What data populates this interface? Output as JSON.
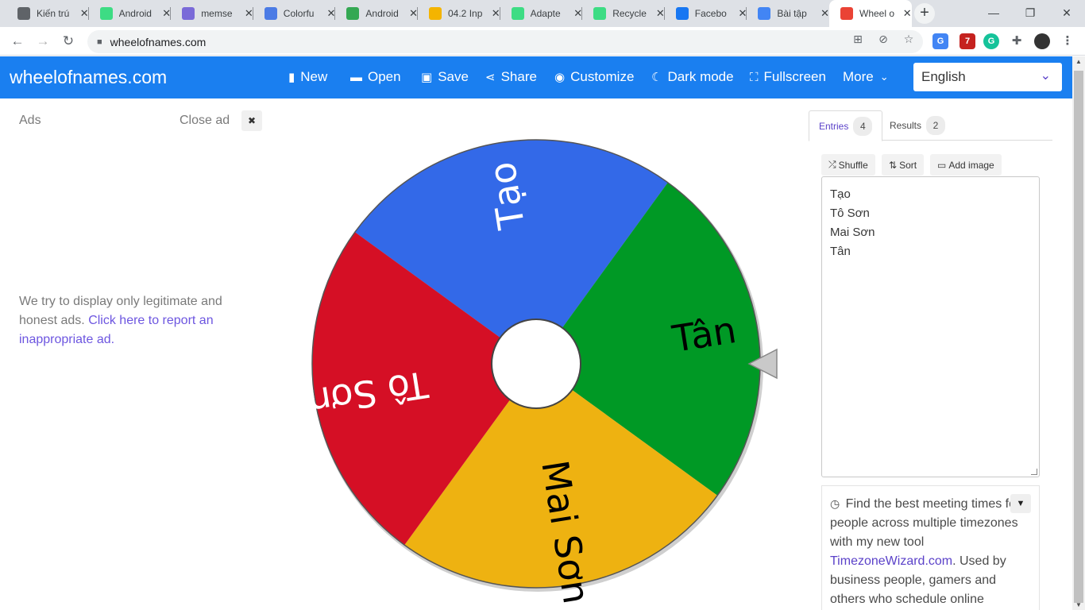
{
  "browser": {
    "tabs": [
      {
        "label": "Kiến trú",
        "fav_color": "#5f6368"
      },
      {
        "label": "Android",
        "fav_color": "#3ddc84"
      },
      {
        "label": "memse",
        "fav_color": "#7a6ad8"
      },
      {
        "label": "Colorfu",
        "fav_color": "#4b7be5"
      },
      {
        "label": "Android",
        "fav_color": "#34a853"
      },
      {
        "label": "04.2 Inp",
        "fav_color": "#f4b400"
      },
      {
        "label": "Adapte",
        "fav_color": "#3ddc84"
      },
      {
        "label": "Recycle",
        "fav_color": "#3ddc84"
      },
      {
        "label": "Facebo",
        "fav_color": "#1877f2"
      },
      {
        "label": "Bài tập",
        "fav_color": "#4285f4"
      },
      {
        "label": "Wheel o",
        "fav_color": "#ea4335"
      }
    ],
    "close_glyph": "✕",
    "new_tab_glyph": "+",
    "window_controls": [
      "—",
      "❐",
      "✕"
    ],
    "url": "wheelofnames.com",
    "ext_badge": "7"
  },
  "app": {
    "brand": "wheelofnames.com",
    "menu": [
      {
        "icon": "file-icon",
        "glyph": "▮",
        "label": "New"
      },
      {
        "icon": "folder-open-icon",
        "glyph": "▬",
        "label": "Open"
      },
      {
        "icon": "save-icon",
        "glyph": "▣",
        "label": "Save"
      },
      {
        "icon": "share-icon",
        "glyph": "⋖",
        "label": "Share"
      },
      {
        "icon": "palette-icon",
        "glyph": "◉",
        "label": "Customize"
      },
      {
        "icon": "moon-icon",
        "glyph": "☾",
        "label": "Dark mode"
      },
      {
        "icon": "fullscreen-icon",
        "glyph": "⛶",
        "label": "Fullscreen"
      }
    ],
    "more_label": "More",
    "language": "English"
  },
  "ads": {
    "label": "Ads",
    "close_label": "Close ad",
    "note_text": "We try to display only legitimate and honest ads.",
    "note_link": "Click here to report an inappropriate ad."
  },
  "wheel": {
    "segments": [
      {
        "name": "Tạo",
        "color": "#3369e8"
      },
      {
        "name": "Tân",
        "color": "#009925"
      },
      {
        "name": "Mai Sơn",
        "color": "#eeb211"
      },
      {
        "name": "Tô Sơn",
        "color": "#d50f25"
      }
    ]
  },
  "panel": {
    "tabs": [
      {
        "label": "Entries",
        "count": "4"
      },
      {
        "label": "Results",
        "count": "2"
      }
    ],
    "tools": [
      {
        "icon": "shuffle-icon",
        "glyph": "⤮",
        "label": "Shuffle"
      },
      {
        "icon": "sort-icon",
        "glyph": "⇅",
        "label": "Sort"
      },
      {
        "icon": "image-icon",
        "glyph": "▭",
        "label": "Add image"
      }
    ],
    "entries": [
      "Tạo",
      "Tô Sơn",
      "Mai Sơn",
      "Tân"
    ],
    "promo": {
      "text_before": "Find the best meeting times for people across multiple timezones with my new tool",
      "link": "TimezoneWizard.com",
      "text_after": ". Used by business people, gamers and others who schedule online meetings."
    }
  }
}
